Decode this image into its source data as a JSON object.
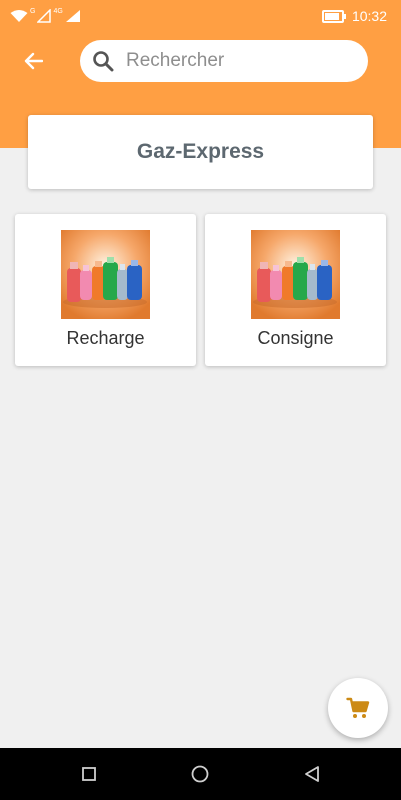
{
  "status_bar": {
    "network_1": "G",
    "network_2": "4G",
    "time": "10:32",
    "icons": [
      "wifi-icon",
      "signal-icon",
      "battery-icon"
    ]
  },
  "header": {
    "back_icon": "arrow-left-icon",
    "search": {
      "placeholder": "Rechercher",
      "value": "",
      "icon": "search-icon"
    }
  },
  "store": {
    "title": "Gaz-Express"
  },
  "categories": [
    {
      "label": "Recharge",
      "image": "gas-cylinders-image"
    },
    {
      "label": "Consigne",
      "image": "gas-cylinders-image"
    }
  ],
  "cart_button": {
    "icon": "cart-icon"
  },
  "navigation": {
    "icons": [
      "recent-apps-icon",
      "home-icon",
      "back-triangle-icon"
    ]
  },
  "colors": {
    "accent": "#ff9f43",
    "cart_icon": "#cc8a15",
    "title_text": "#5d6870",
    "background": "#f0f0f0"
  }
}
